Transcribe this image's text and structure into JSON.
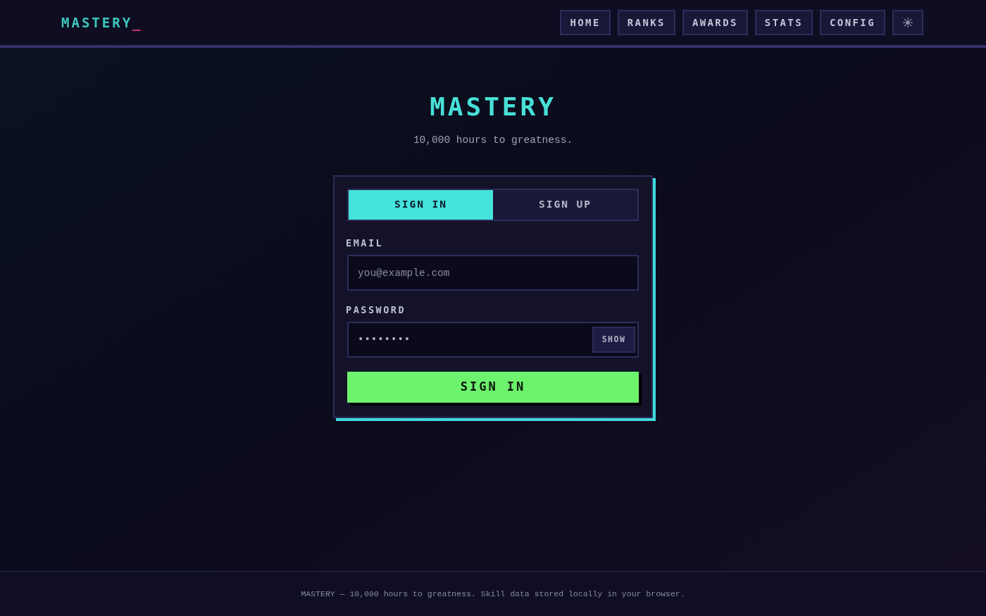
{
  "header": {
    "logo": {
      "text": "MASTERY",
      "cursor": "_"
    },
    "nav": [
      {
        "label": "HOME"
      },
      {
        "label": "RANKS"
      },
      {
        "label": "AWARDS"
      },
      {
        "label": "STATS"
      },
      {
        "label": "CONFIG"
      }
    ]
  },
  "hero": {
    "title": "MASTERY",
    "subtitle": "10,000 hours to greatness."
  },
  "auth_form": {
    "tabs": [
      {
        "label": "SIGN IN",
        "selected": true
      },
      {
        "label": "SIGN UP",
        "selected": false
      }
    ],
    "fields": [
      {
        "kind": "text",
        "label": "EMAIL",
        "placeholder": "you@example.com"
      },
      {
        "kind": "password",
        "label": "PASSWORD",
        "value": "••••••••",
        "toggle": "SHOW"
      }
    ],
    "submit": "SIGN IN"
  },
  "footer": {
    "text": "MASTERY — 10,000 hours to greatness. Skill data stored locally in your browser."
  }
}
